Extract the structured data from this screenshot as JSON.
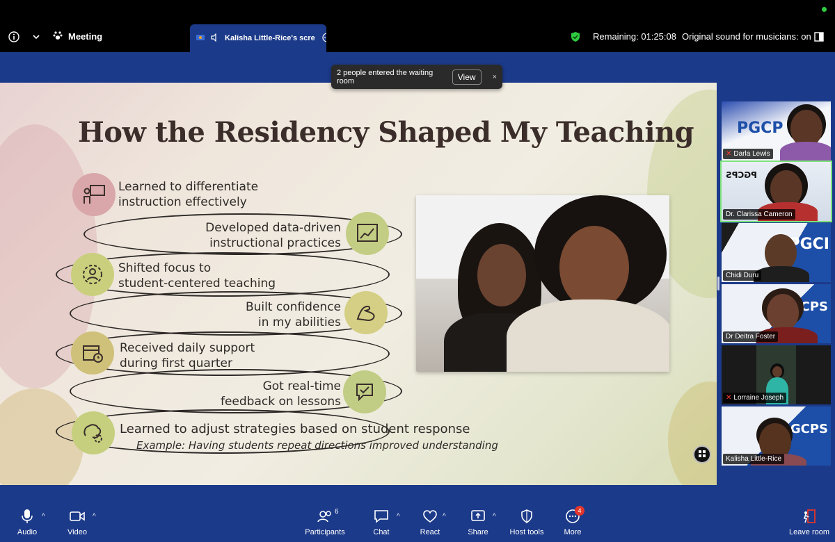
{
  "topbar": {
    "meeting_label": "Meeting",
    "tab_label": "Kalisha Little-Rice's scre",
    "remaining": "Remaining: 01:25:08",
    "sound": "Original sound for musicians: on"
  },
  "toast": {
    "message": "2 people entered the waiting room",
    "view_label": "View",
    "close_glyph": "×"
  },
  "slide": {
    "title": "How the Residency Shaped My Teaching",
    "items": [
      {
        "line1": "Learned to differentiate",
        "line2": "instruction effectively",
        "icon": "presentation-icon"
      },
      {
        "line1": "Developed data-driven",
        "line2": "instructional practices",
        "icon": "chart-icon"
      },
      {
        "line1": "Shifted focus to",
        "line2": "student-centered teaching",
        "icon": "student-icon"
      },
      {
        "line1": "Built confidence",
        "line2": "in my abilities",
        "icon": "muscle-icon"
      },
      {
        "line1": "Received daily support",
        "line2": "during first quarter",
        "icon": "calendar-icon"
      },
      {
        "line1": "Got real-time",
        "line2": "feedback on lessons",
        "icon": "chat-check-icon"
      },
      {
        "line1": "Learned to adjust strategies based on student response",
        "line2": "Example: Having students repeat directions improved understanding",
        "icon": "brain-gear-icon"
      }
    ]
  },
  "gallery": [
    {
      "name": "Darla Lewis",
      "muted": true,
      "logo": "PGCP"
    },
    {
      "name": "Dr. Clarissa Cameron",
      "muted": false,
      "logo": "PGCPS"
    },
    {
      "name": "Chidi Duru",
      "muted": false,
      "logo": "PGCI"
    },
    {
      "name": "Dr Deitra Foster",
      "muted": false,
      "logo": "PGCPS"
    },
    {
      "name": "Lorraine Joseph",
      "muted": true,
      "logo": ""
    },
    {
      "name": "Kalisha Little-Rice",
      "muted": false,
      "logo": "PGCPS"
    }
  ],
  "toolbar": {
    "audio": "Audio",
    "video": "Video",
    "participants": "Participants",
    "participants_count": "6",
    "chat": "Chat",
    "react": "React",
    "share": "Share",
    "host_tools": "Host tools",
    "more": "More",
    "more_badge": "4",
    "leave": "Leave room"
  },
  "colors": {
    "background": "#1c3a8a",
    "active_speaker": "#7de37d",
    "shield": "#2ecc40",
    "badge": "#e2352b"
  }
}
